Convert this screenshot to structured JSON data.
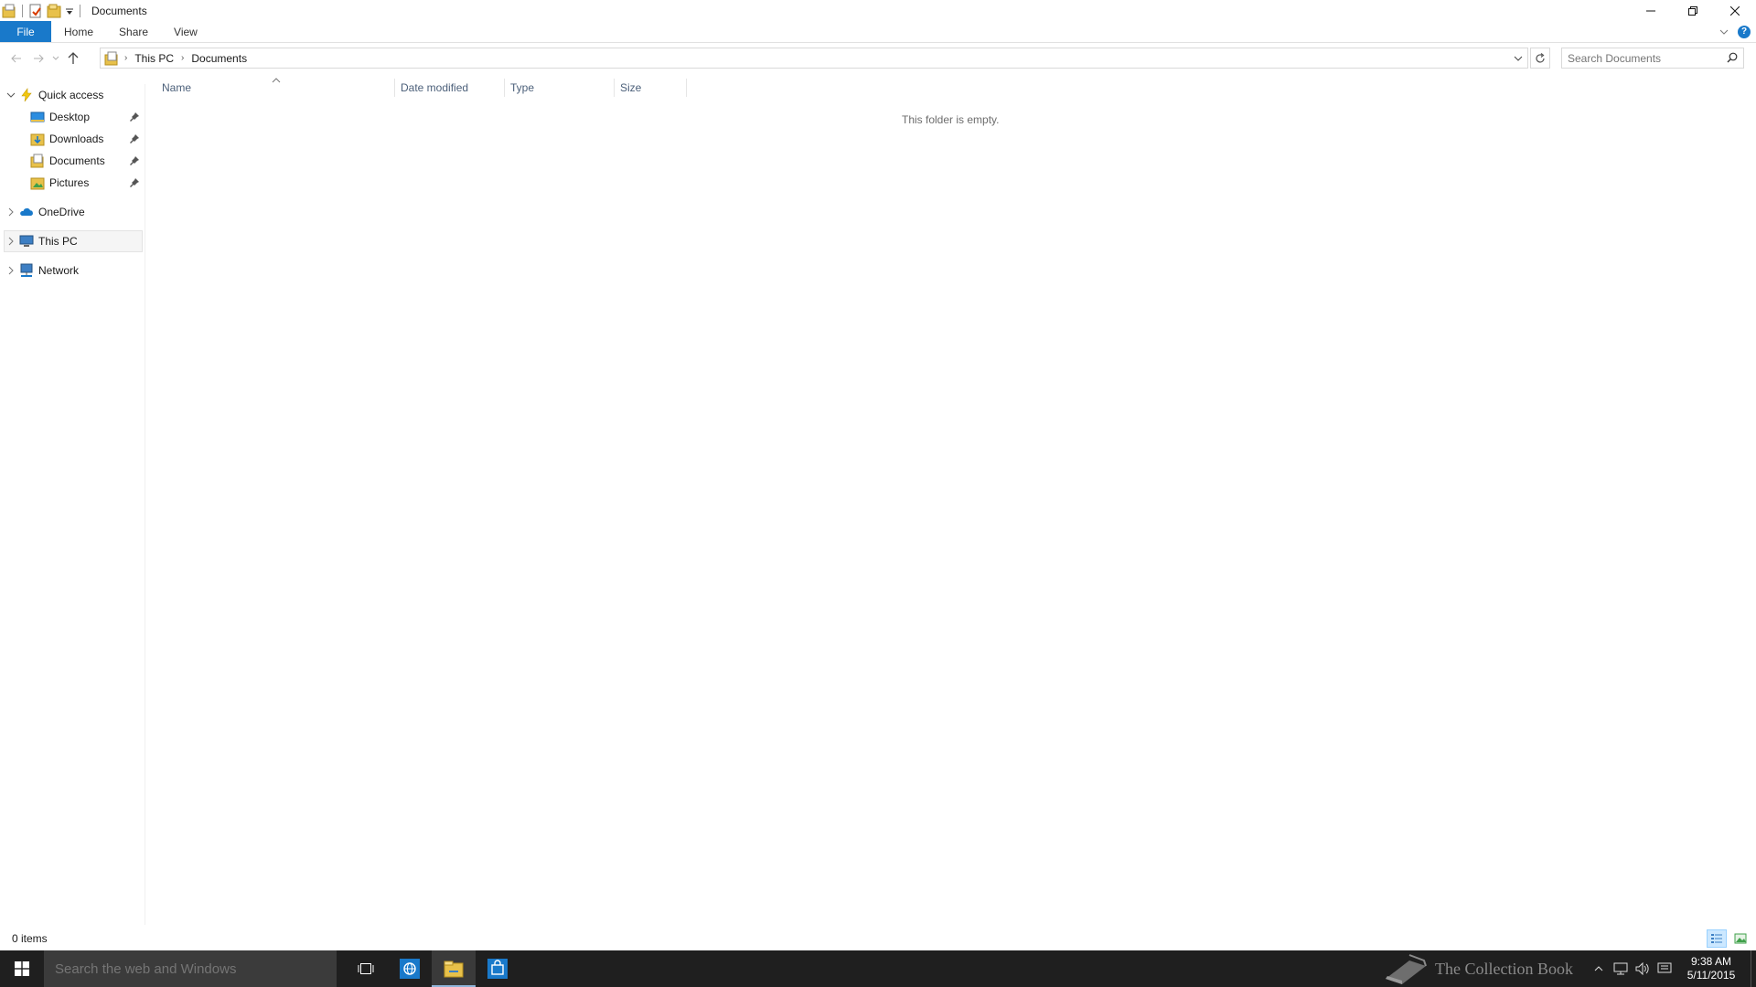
{
  "window": {
    "title": "Documents",
    "controls": {
      "minimize": "minimize",
      "restore": "restore",
      "close": "close"
    }
  },
  "ribbon": {
    "tabs": [
      {
        "label": "File"
      },
      {
        "label": "Home"
      },
      {
        "label": "Share"
      },
      {
        "label": "View"
      }
    ]
  },
  "address": {
    "crumbs": [
      "This PC",
      "Documents"
    ]
  },
  "search": {
    "placeholder": "Search Documents"
  },
  "nav": {
    "quick_access": "Quick access",
    "pinned": [
      {
        "label": "Desktop"
      },
      {
        "label": "Downloads"
      },
      {
        "label": "Documents"
      },
      {
        "label": "Pictures"
      }
    ],
    "onedrive": "OneDrive",
    "this_pc": "This PC",
    "network": "Network"
  },
  "columns": {
    "name": "Name",
    "date_modified": "Date modified",
    "type": "Type",
    "size": "Size"
  },
  "content": {
    "empty_message": "This folder is empty."
  },
  "status": {
    "item_count": "0 items"
  },
  "taskbar": {
    "search_placeholder": "Search the web and Windows",
    "time": "9:38 AM",
    "date": "5/11/2015",
    "watermark": "The Collection Book"
  },
  "colors": {
    "accent": "#1979ca",
    "taskbar": "#1f1f1f",
    "folder": "#e8c14a"
  }
}
